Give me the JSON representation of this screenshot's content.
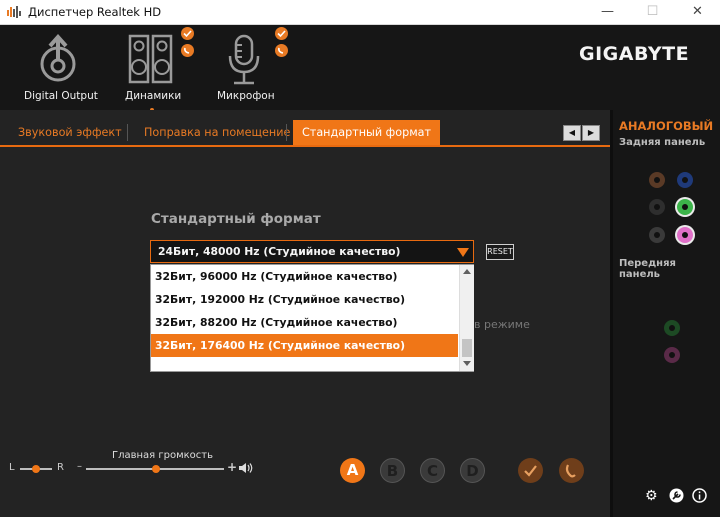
{
  "window": {
    "title": "Диспетчер Realtek HD",
    "minimize": "—",
    "maximize": "☐",
    "close": "✕"
  },
  "devices": [
    {
      "label": "Digital Output",
      "icon": "digital-output-icon"
    },
    {
      "label": "Динамики",
      "icon": "speakers-icon",
      "active": true
    },
    {
      "label": "Микрофон",
      "icon": "microphone-icon"
    }
  ],
  "brand": "GIGABYTE",
  "tabs": [
    {
      "label": "Звуковой эффект"
    },
    {
      "label": "Поправка на помещение"
    },
    {
      "label": "Стандартный формат",
      "active": true
    }
  ],
  "tab_nav": {
    "prev": "◀",
    "next": "▶"
  },
  "format": {
    "section_title": "Стандартный формат",
    "selected": "24Бит, 48000 Hz (Студийное качество)",
    "reset": "RESET",
    "partial_hint": "в режиме",
    "options": [
      "32Бит, 96000 Hz (Студийное качество)",
      "32Бит, 192000 Hz (Студийное качество)",
      "32Бит, 88200 Hz (Студийное качество)",
      "32Бит, 176400 Hz (Студийное качество)"
    ],
    "highlighted_option": "32Бит, 176400 Hz (Студийное качество)"
  },
  "volume": {
    "label": "Главная громкость",
    "balance_left": "L",
    "balance_right": "R",
    "minus": "–",
    "plus": "+",
    "speaker_symbol": "🔊",
    "balance_level": 0.5,
    "volume_level": 0.55
  },
  "presets": [
    "A",
    "B",
    "C",
    "D"
  ],
  "active_preset": "A",
  "right_panel": {
    "title": "АНАЛОГОВЫЙ",
    "rear_label": "Задняя панель",
    "front_label": "Передняя панель"
  },
  "colors": {
    "accent": "#f07617",
    "background": "#232323",
    "jack_green": "#3cb44a",
    "jack_pink": "#e070c8",
    "jack_blue": "#2c4aa8"
  }
}
